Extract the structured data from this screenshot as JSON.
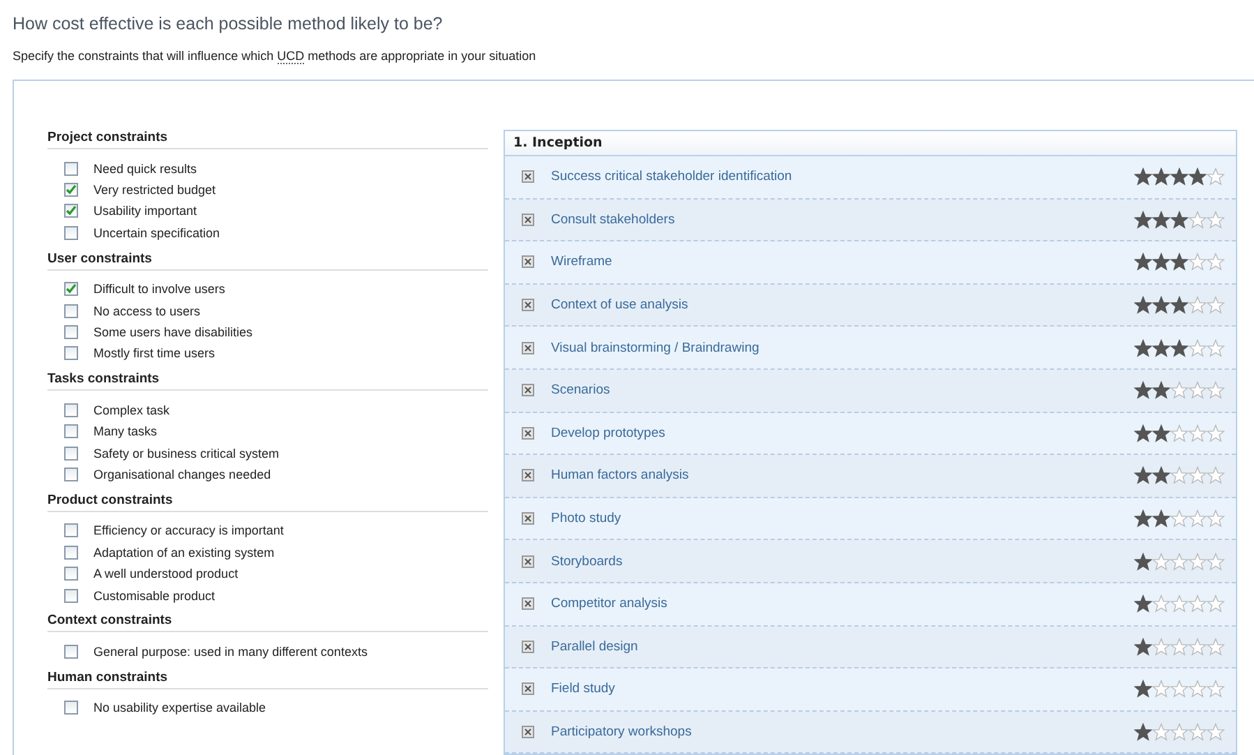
{
  "title": "How cost effective is each possible method likely to be?",
  "subtitle": {
    "before": "Specify the constraints that will influence which ",
    "abbr": "UCD",
    "after": " methods are appropriate in your situation"
  },
  "constraint_groups": [
    {
      "heading": "Project constraints",
      "items": [
        {
          "label": "Need quick results",
          "checked": false
        },
        {
          "label": "Very restricted budget",
          "checked": true
        },
        {
          "label": "Usability important",
          "checked": true
        },
        {
          "label": "Uncertain specification",
          "checked": false
        }
      ]
    },
    {
      "heading": "User constraints",
      "items": [
        {
          "label": "Difficult to involve users",
          "checked": true
        },
        {
          "label": "No access to users",
          "checked": false
        },
        {
          "label": "Some users have disabilities",
          "checked": false
        },
        {
          "label": "Mostly first time users",
          "checked": false
        }
      ]
    },
    {
      "heading": "Tasks constraints",
      "items": [
        {
          "label": "Complex task",
          "checked": false
        },
        {
          "label": "Many tasks",
          "checked": false
        },
        {
          "label": "Safety or business critical system",
          "checked": false
        },
        {
          "label": "Organisational changes needed",
          "checked": false
        }
      ]
    },
    {
      "heading": "Product constraints",
      "items": [
        {
          "label": "Efficiency or accuracy is important",
          "checked": false
        },
        {
          "label": "Adaptation of an existing system",
          "checked": false
        },
        {
          "label": "A well understood product",
          "checked": false
        },
        {
          "label": "Customisable product",
          "checked": false
        }
      ]
    },
    {
      "heading": "Context constraints",
      "items": [
        {
          "label": "General purpose: used in many different contexts",
          "checked": false
        }
      ]
    },
    {
      "heading": "Human constraints",
      "items": [
        {
          "label": "No usability expertise available",
          "checked": false
        }
      ]
    }
  ],
  "phase": {
    "title": "1. Inception",
    "methods": [
      {
        "name": "Success critical stakeholder identification",
        "stars": 4
      },
      {
        "name": "Consult stakeholders",
        "stars": 3
      },
      {
        "name": "Wireframe",
        "stars": 3
      },
      {
        "name": "Context of use analysis",
        "stars": 3
      },
      {
        "name": "Visual brainstorming / Braindrawing",
        "stars": 3
      },
      {
        "name": "Scenarios",
        "stars": 2
      },
      {
        "name": "Develop prototypes",
        "stars": 2
      },
      {
        "name": "Human factors analysis",
        "stars": 2
      },
      {
        "name": "Photo study",
        "stars": 2
      },
      {
        "name": "Storyboards",
        "stars": 1
      },
      {
        "name": "Competitor analysis",
        "stars": 1
      },
      {
        "name": "Parallel design",
        "stars": 1
      },
      {
        "name": "Field study",
        "stars": 1
      },
      {
        "name": "Participatory workshops",
        "stars": 1
      }
    ]
  }
}
